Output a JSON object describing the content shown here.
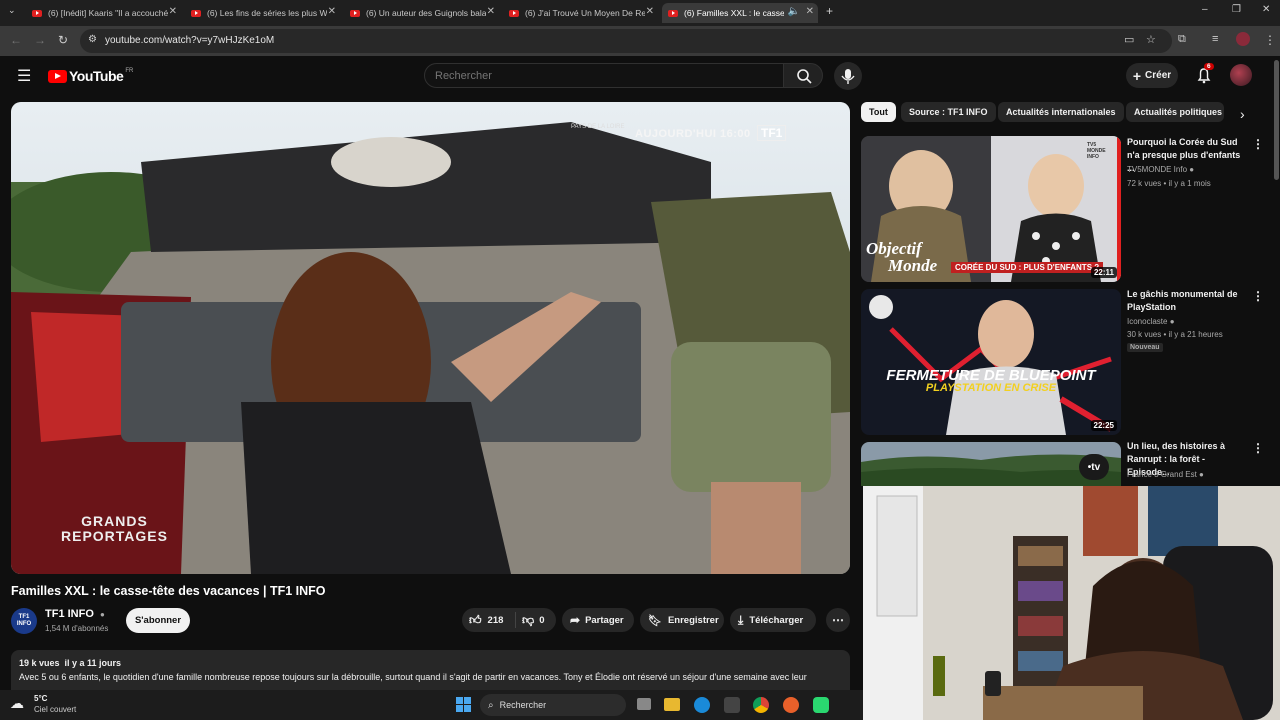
{
  "browser": {
    "tabs": [
      {
        "label": "(6) [Inédit] Kaaris \"Il a accouché"
      },
      {
        "label": "(6) Les fins de séries les plus W"
      },
      {
        "label": "(6) Un auteur des Guignols bala"
      },
      {
        "label": "(6) J'ai Trouvé Un Moyen De Re"
      },
      {
        "label": "(6) Familles XXL : le casse-tê"
      }
    ],
    "url": "youtube.com/watch?v=y7wHJzKe1oM"
  },
  "header": {
    "logo_text": "YouTube",
    "region": "FR",
    "search_placeholder": "Rechercher",
    "create_label": "Créer",
    "notification_count": "6"
  },
  "video": {
    "overlay_time": "AUJOURD'HUI 16:00",
    "overlay_channel_logo": "TF1",
    "overlay_region": "PAYS DE LA LOIRE",
    "overlay_show": "GRANDS\nREPORTAGES",
    "title": "Familles XXL : le casse-tête des vacances | TF1 INFO",
    "channel_name": "TF1 INFO",
    "channel_avatar_text": "TF1 INFO",
    "subscribers": "1,54 M d'abonnés",
    "subscribe_label": "S'abonner",
    "likes": "218",
    "dislikes": "0",
    "share_label": "Partager",
    "save_label": "Enregistrer",
    "download_label": "Télécharger",
    "views_date": "19 k vues  il y a 11 jours",
    "description": "Avec 5 ou 6 enfants, le quotidien d'une famille nombreuse repose toujours sur la débrouille, surtout quand il s'agit de partir en vacances. Tony et Élodie ont réservé un séjour d'une semaine avec leur"
  },
  "chips": [
    "Tout",
    "Source : TF1 INFO",
    "Actualités internationales",
    "Actualités politiques"
  ],
  "recommendations": [
    {
      "title": "Pourquoi la Corée du Sud n'a presque plus d'enfants ...",
      "channel": "TV5MONDE Info",
      "meta": "72 k vues • il y a 1 mois",
      "duration": "22:11",
      "thumb_text_1": "Objectif",
      "thumb_text_2": "Monde",
      "thumb_banner": "CORÉE DU SUD : PLUS D'ENFANTS ?",
      "thumb_logo": "TV5 MONDE INFO"
    },
    {
      "title": "Le gâchis monumental de PlayStation",
      "channel": "Iconoclaste",
      "meta": "30 k vues • il y a 21 heures",
      "badge": "Nouveau",
      "duration": "22:25",
      "thumb_text_1": "FERMETURE DE BLUEPOINT",
      "thumb_text_2": "PLAYSTATION EN CRISE"
    },
    {
      "title": "Un lieu, des histoires à Ranrupt : la forêt - Episode...",
      "channel": "France 3 Grand Est",
      "thumb_logo": "•tv"
    }
  ],
  "taskbar": {
    "temperature": "5°C",
    "weather": "Ciel couvert",
    "search_label": "Rechercher"
  },
  "colors": {
    "youtube_red": "#ff0000",
    "background": "#0f0f0f",
    "surface": "#272727",
    "text_secondary": "#aaaaaa"
  }
}
